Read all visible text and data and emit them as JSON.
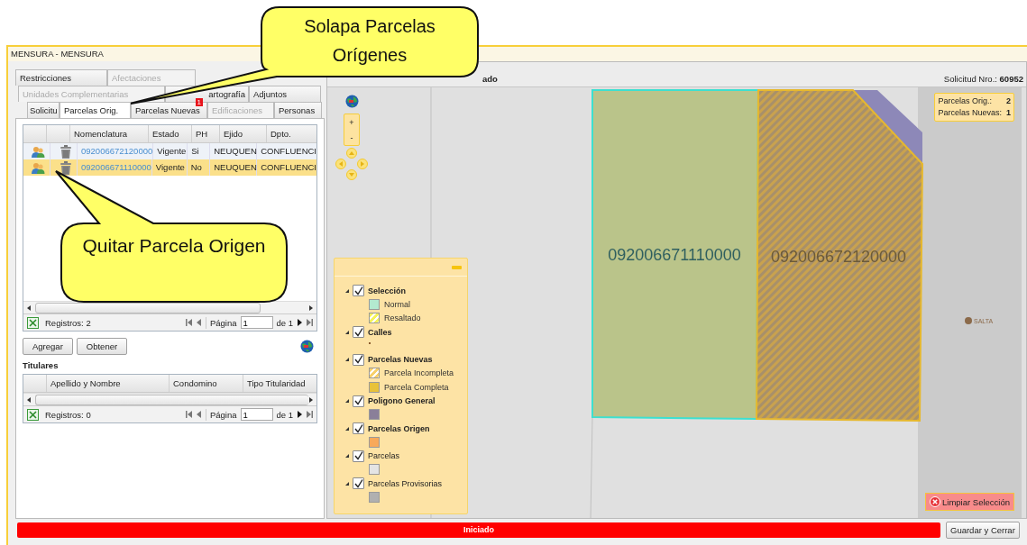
{
  "window": {
    "title": "MENSURA - MENSURA"
  },
  "tab_rows": [
    [
      {
        "label": "Restricciones",
        "selected": false,
        "disabled": false
      },
      {
        "label": "Afectaciones",
        "selected": false,
        "disabled": true
      }
    ],
    [
      {
        "label": "Unidades Complementarias",
        "selected": false,
        "disabled": true
      },
      {
        "label": "artografía",
        "selected": false,
        "disabled": false
      },
      {
        "label": "Adjuntos",
        "selected": false,
        "disabled": false
      }
    ],
    [
      {
        "label": "Solicitu",
        "selected": false,
        "disabled": false
      },
      {
        "label": "Parcelas Orig.",
        "selected": true,
        "disabled": false
      },
      {
        "label": "Parcelas Nuevas",
        "selected": false,
        "disabled": false,
        "badge": "1"
      },
      {
        "label": "Edificaciones",
        "selected": false,
        "disabled": true
      },
      {
        "label": "Personas",
        "selected": false,
        "disabled": false
      }
    ]
  ],
  "parcels_grid": {
    "columns": [
      "Nomenclatura",
      "Estado",
      "PH",
      "Ejido",
      "Dpto."
    ],
    "rows": [
      {
        "selected": false,
        "cells": [
          "092006672120000",
          "Vigente",
          "Si",
          "NEUQUEN",
          "CONFLUENCI"
        ]
      },
      {
        "selected": true,
        "cells": [
          "092006671110000",
          "Vigente",
          "No",
          "NEUQUEN",
          "CONFLUENCI"
        ]
      }
    ],
    "footer": {
      "records": "Registros: 2",
      "page_label": "Página",
      "page": "1",
      "of": "de 1"
    }
  },
  "buttons": [
    "Agregar",
    "Obtener"
  ],
  "titulares": {
    "title": "Titulares",
    "columns": [
      "Apellido y Nombre",
      "Condomino",
      "Tipo Titularidad"
    ],
    "footer": {
      "records": "Registros: 0",
      "page_label": "Página",
      "page": "1",
      "of": "de 1"
    }
  },
  "map": {
    "header_fragment": "ado",
    "request_label": "Solicitud Nro.:",
    "request_number": "60952",
    "zoom_in": "+",
    "zoom_out": "-",
    "summary": [
      {
        "label": "Parcelas Orig.:",
        "value": "2"
      },
      {
        "label": "Parcelas Nuevas:",
        "value": "1"
      }
    ],
    "parcels": [
      {
        "kind": "selected",
        "label": "092006671110000"
      },
      {
        "kind": "new",
        "label": "092006672120000"
      }
    ],
    "place": "SALTA",
    "clear_button": "Limpiar Selección"
  },
  "legend": {
    "groups": [
      {
        "label": "Selección",
        "checked": true,
        "expanded": true,
        "emphasized": true,
        "items": [
          {
            "label": "Normal",
            "kind": "solid",
            "color": "#b3ead0"
          },
          {
            "label": "Resaltado",
            "kind": "hatched",
            "color": "#f5f25a"
          }
        ]
      },
      {
        "label": "Calles",
        "checked": true,
        "expanded": true,
        "emphasized": true,
        "items": [
          {
            "kind": "dot",
            "color": "#8b5a2b"
          }
        ]
      },
      {
        "label": "Parcelas Nuevas",
        "checked": true,
        "expanded": true,
        "emphasized": true,
        "items": [
          {
            "label": "Parcela Incompleta",
            "kind": "hatched",
            "color": "#f7cf6a"
          },
          {
            "label": "Parcela Completa",
            "kind": "solid",
            "color": "#e8c23a"
          }
        ]
      },
      {
        "label": "Poligono General",
        "checked": true,
        "expanded": true,
        "emphasized": true,
        "items": [
          {
            "kind": "solid",
            "color": "#8a7f99"
          }
        ]
      },
      {
        "label": "Parcelas Origen",
        "checked": true,
        "expanded": true,
        "emphasized": true,
        "items": [
          {
            "kind": "solid",
            "color": "#f8a95a"
          }
        ]
      },
      {
        "label": "Parcelas",
        "checked": true,
        "expanded": true,
        "emphasized": false,
        "items": [
          {
            "kind": "solid",
            "color": "#e4e4e4"
          }
        ]
      },
      {
        "label": "Parcelas Provisorias",
        "checked": true,
        "expanded": true,
        "emphasized": false,
        "items": [
          {
            "kind": "solid",
            "color": "#b0b0b0"
          }
        ]
      }
    ]
  },
  "status": {
    "label": "Iniciado"
  },
  "save_button": "Guardar y Cerrar",
  "callouts": [
    "Solapa Parcelas Orígenes",
    "Quitar Parcela Origen"
  ]
}
